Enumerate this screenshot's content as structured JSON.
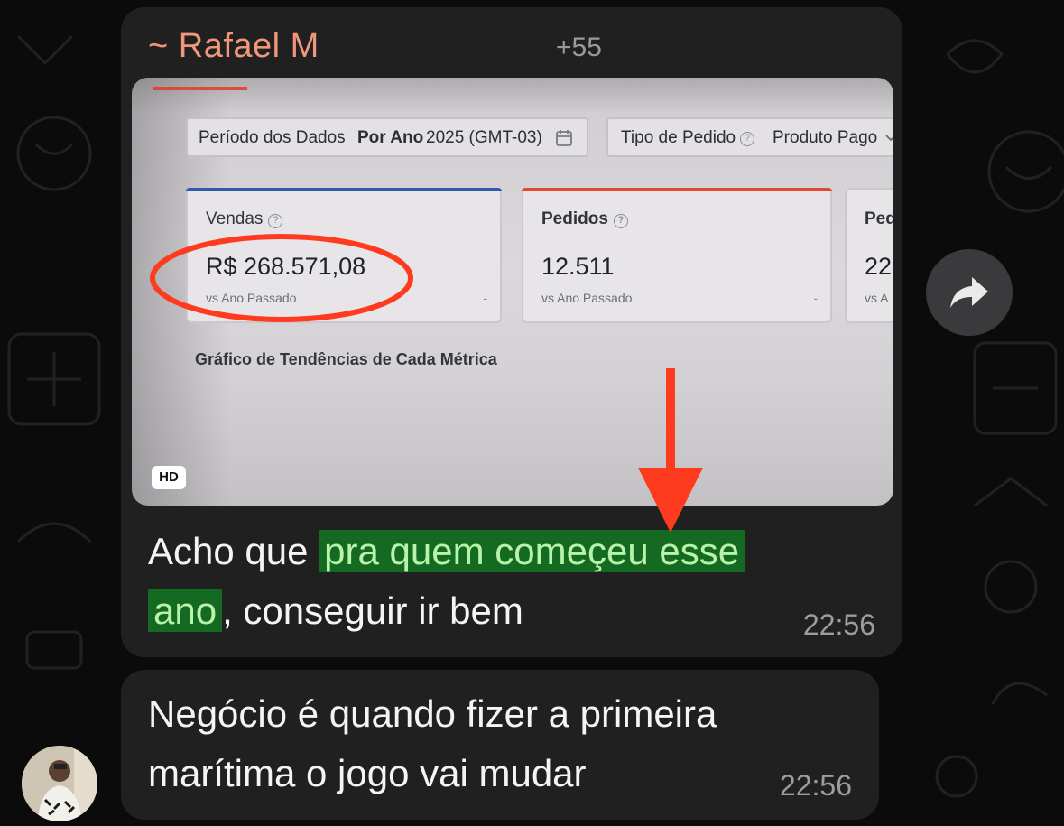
{
  "message1": {
    "sender": "~ Rafael M",
    "phone": "+55",
    "media": {
      "filter": {
        "period_label": "Período dos Dados",
        "period_value": "Por Ano",
        "period_year": "2025 (GMT-03)",
        "order_type_label": "Tipo de Pedido",
        "order_type_value": "Produto Pago"
      },
      "cards": [
        {
          "title": "Vendas",
          "value": "R$ 268.571,08",
          "subtitle": "vs Ano Passado",
          "dash": "-"
        },
        {
          "title": "Pedidos",
          "value": "12.511",
          "subtitle": "vs Ano Passado",
          "dash": "-"
        },
        {
          "title": "Pedi",
          "value": "22",
          "subtitle": "vs A"
        }
      ],
      "chart_title": "Gráfico de Tendências de Cada Métrica",
      "hd_badge": "HD"
    },
    "text_before": "Acho que ",
    "text_highlight_1": "pra quem começeu esse",
    "text_highlight_2": "ano",
    "text_after": ", conseguir ir bem",
    "time": "22:56"
  },
  "message2": {
    "line1": "Negócio é quando fizer a primeira",
    "line2": "marítima o jogo vai mudar",
    "time": "22:56"
  },
  "colors": {
    "sender": "#f0967a",
    "highlight_bg": "#146a22",
    "highlight_text": "#b8f3a8",
    "bubble": "#202020",
    "annotation_red": "#ff3b1f"
  },
  "icons": {
    "forward": "forward-arrow-icon",
    "calendar": "calendar-icon",
    "chevron": "chevron-down-icon",
    "help": "question-circle-icon"
  }
}
